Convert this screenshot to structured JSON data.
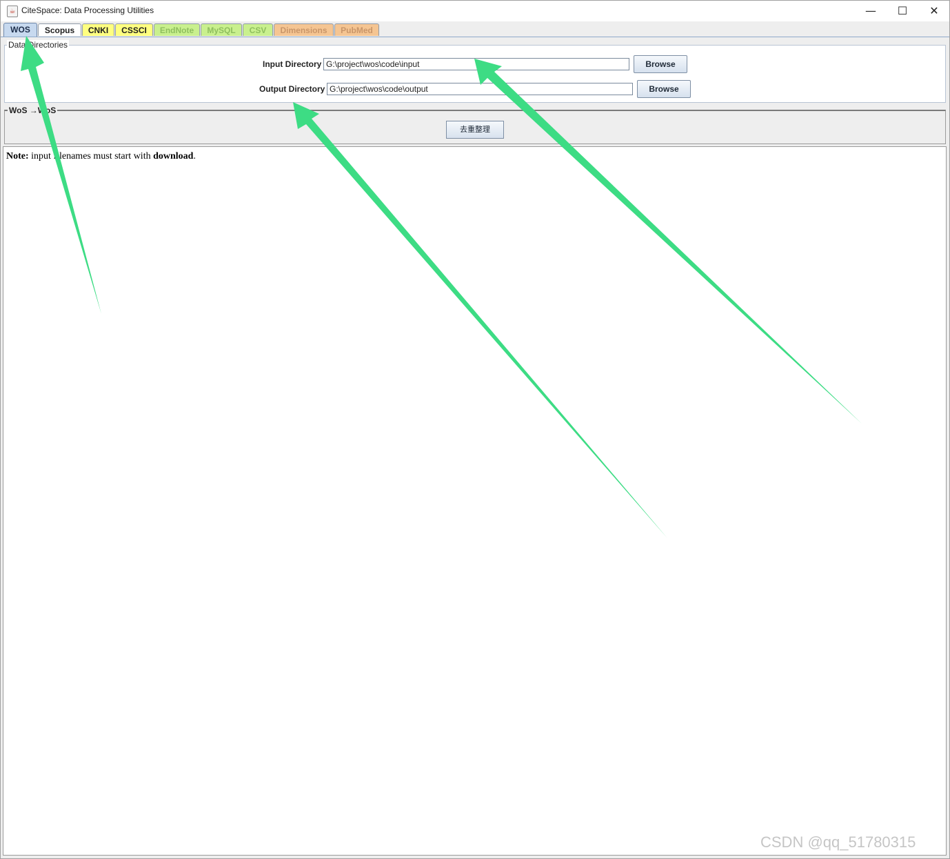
{
  "window": {
    "title": "CiteSpace: Data Processing Utilities",
    "icon": "java-cup-icon",
    "controls": {
      "minimize": "—",
      "maximize": "☐",
      "close": "✕"
    }
  },
  "tabs": [
    {
      "label": "WOS",
      "selected": true,
      "color": "#c7d9ef",
      "text_color": "#1c2d4a"
    },
    {
      "label": "Scopus",
      "selected": false,
      "color": "#ffffff",
      "text_color": "#1f1f1f"
    },
    {
      "label": "CNKI",
      "selected": false,
      "color": "#ffff80",
      "text_color": "#1f1f1f"
    },
    {
      "label": "CSSCI",
      "selected": false,
      "color": "#ffff80",
      "text_color": "#1f1f1f"
    },
    {
      "label": "EndNote",
      "selected": false,
      "color": "#c9f08e",
      "text_color": "#8fbf5f"
    },
    {
      "label": "MySQL",
      "selected": false,
      "color": "#c9f08e",
      "text_color": "#8fbf5f"
    },
    {
      "label": "CSV",
      "selected": false,
      "color": "#c9f08e",
      "text_color": "#8fbf5f"
    },
    {
      "label": "Dimensions",
      "selected": false,
      "color": "#f5c592",
      "text_color": "#c9966a"
    },
    {
      "label": "PubMed",
      "selected": false,
      "color": "#f5c592",
      "text_color": "#c9966a"
    }
  ],
  "directories": {
    "legend": "Data Directories",
    "input_label": "Input Directory",
    "input_value": "G:\\project\\wos\\code\\input",
    "output_label": "Output Directory",
    "output_value": "G:\\project\\wos\\code\\output",
    "browse_label": "Browse"
  },
  "wos_panel": {
    "legend": "WoS →WoS",
    "dedup_button": "去重整理"
  },
  "note": {
    "prefix": "Note:",
    "middle": " input filenames must start with ",
    "keyword": "download",
    "suffix": "."
  },
  "watermark": "CSDN @qq_51780315",
  "annotation_color": "#3ddc84"
}
